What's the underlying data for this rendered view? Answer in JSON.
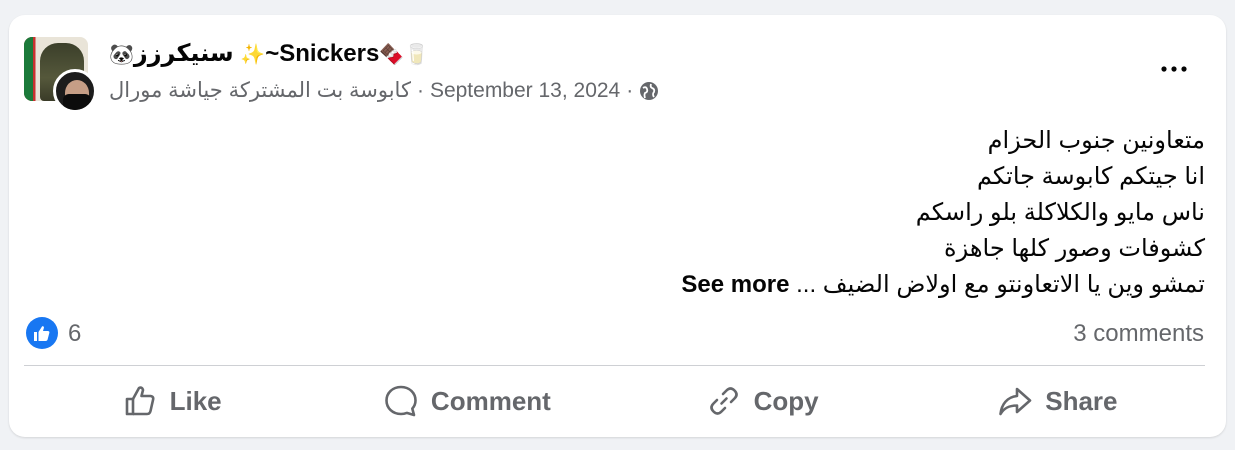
{
  "post": {
    "author_name": "~Snickers",
    "author_prefix_arabic": "سنيكرزز",
    "author_emojis": {
      "bear": "🐼",
      "sparkle": "✨",
      "chocolate": "🍫",
      "milk": "🥛"
    },
    "group_name": "كابوسة بت المشتركة جياشة مورال",
    "separator": "·",
    "date": "September 13, 2024",
    "privacy_icon": "globe-icon",
    "body_lines": [
      "متعاونين جنوب الحزام",
      "انا جيتكم كابوسة جاتكم",
      "ناس مايو والكلاكلة بلو راسكم",
      "كشوفات وصور كلها جاهزة"
    ],
    "truncated_line": "تمشو وين يا الاتعاونتو مع اولاض الضيف ...",
    "see_more_label": "See more",
    "reaction_count": "6",
    "comments_label": "3 comments"
  },
  "actions": {
    "like": "Like",
    "comment": "Comment",
    "copy": "Copy",
    "share": "Share"
  },
  "colors": {
    "background": "#f0f2f5",
    "card": "#ffffff",
    "secondary_text": "#65676b",
    "like_blue": "#1877f2",
    "divider": "#ced0d4"
  }
}
